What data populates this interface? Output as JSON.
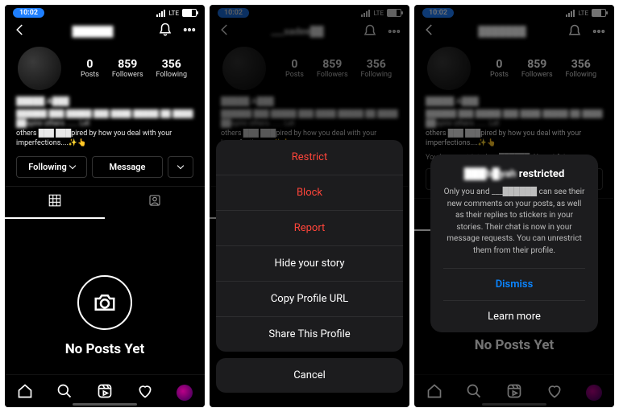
{
  "status": {
    "time": "10:02",
    "carrier": "LTE"
  },
  "header": {
    "usernames": [
      "██████",
      "___sadee██",
      "███████"
    ]
  },
  "profile": {
    "stats": {
      "posts": {
        "value": "0",
        "label": "Posts"
      },
      "followers": {
        "value": "859",
        "label": "Followers"
      },
      "following": {
        "value": "356",
        "label": "Following"
      }
    },
    "display_name": "█████ A███",
    "bio_line1": "██████ ███ █████ ███ ████ █████ ██ ████ ██spire others ...... Let",
    "bio_line2": "others ███ ███pired by how you deal with your",
    "bio_line3": "imperfections....✨👆"
  },
  "restricted_line": {
    "prefix": "You have restricted ___██████. ",
    "action": "Unrestrict"
  },
  "actions": {
    "following": "Following",
    "message": "Message"
  },
  "empty_state": "No Posts Yet",
  "sheet": {
    "restrict": "Restrict",
    "block": "Block",
    "report": "Report",
    "hide": "Hide your story",
    "copy": "Copy Profile URL",
    "share": "Share This Profile",
    "cancel": "Cancel"
  },
  "dialog": {
    "title_name": "███b█yah",
    "title_suffix": " restricted",
    "body": "Only you and ___██████ can see their new comments on your posts, as well as their replies to stickers in your stories. Their chat is now in your message requests. You can unrestrict them from their profile.",
    "dismiss": "Dismiss",
    "learn": "Learn more"
  }
}
